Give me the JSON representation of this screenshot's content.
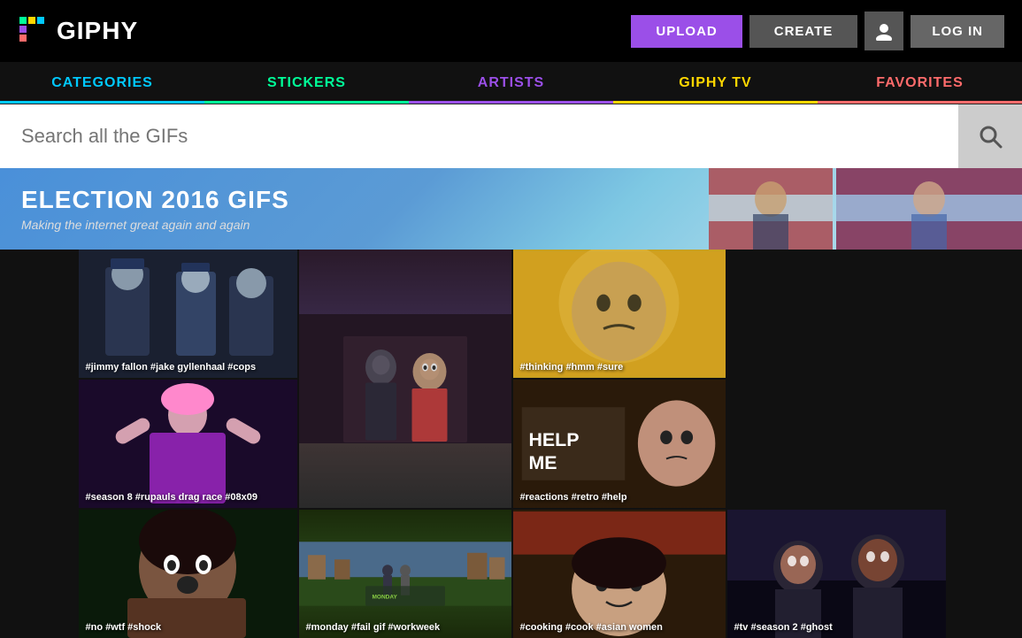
{
  "header": {
    "logo_text": "GIPHY",
    "upload_label": "UPLOAD",
    "create_label": "CREATE",
    "login_label": "LOG IN"
  },
  "nav": {
    "tabs": [
      {
        "id": "categories",
        "label": "CATEGORIES",
        "color": "#00C9FF"
      },
      {
        "id": "stickers",
        "label": "STICKERS",
        "color": "#00FF99"
      },
      {
        "id": "artists",
        "label": "ARTISTS",
        "color": "#9B4FE8"
      },
      {
        "id": "giphytv",
        "label": "GIPHY TV",
        "color": "#FFD700"
      },
      {
        "id": "favorites",
        "label": "FAVORITES",
        "color": "#FF6B6B"
      }
    ]
  },
  "search": {
    "placeholder": "Search all the GIFs"
  },
  "banner": {
    "title": "ELECTION 2016 GIFS",
    "subtitle": "Making the internet great again and again"
  },
  "gifs": [
    {
      "id": "cops",
      "tags": "#jimmy fallon #jake gyllenhaal #cops"
    },
    {
      "id": "think",
      "tags": "#thinking #hmm #sure"
    },
    {
      "id": "drag",
      "tags": "#season 8 #rupauls drag race #08x09"
    },
    {
      "id": "center",
      "tags": ""
    },
    {
      "id": "help",
      "tags": "#reactions #retro #help"
    },
    {
      "id": "shock",
      "tags": "#no #wtf #shock"
    },
    {
      "id": "monday",
      "tags": "#monday #fail gif #workweek"
    },
    {
      "id": "cooking",
      "tags": "#cooking #cook #asian women"
    },
    {
      "id": "tv",
      "tags": "#tv #season 2 #ghost"
    }
  ]
}
